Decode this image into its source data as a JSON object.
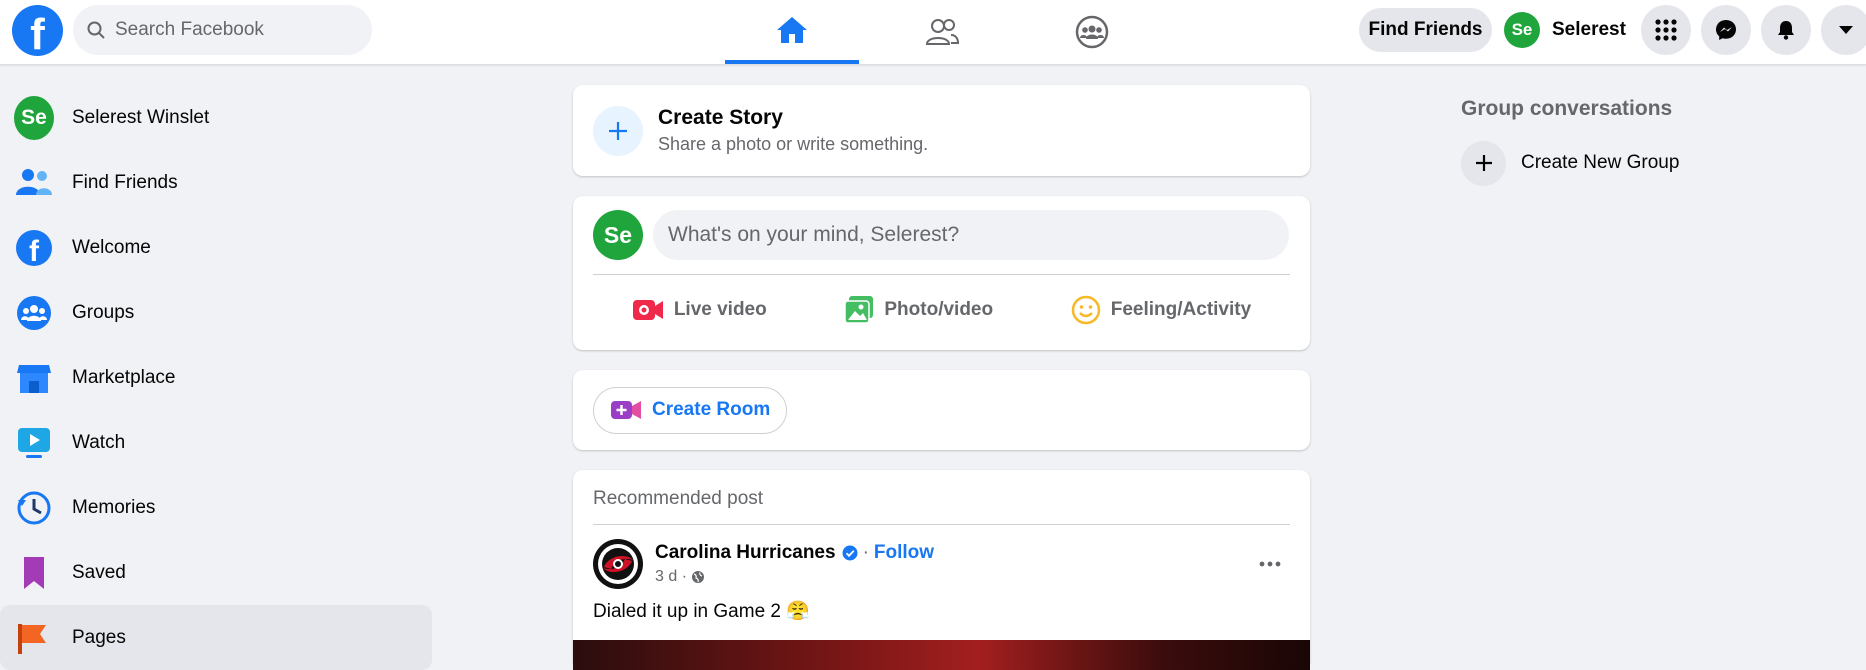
{
  "topbar": {
    "logo_letter": "f",
    "search_placeholder": "Search Facebook",
    "find_friends_label": "Find Friends",
    "profile_name": "Selerest",
    "avatar_text": "Se"
  },
  "left_nav": {
    "items": [
      {
        "label": "Selerest Winslet",
        "icon": "avatar"
      },
      {
        "label": "Find Friends",
        "icon": "friends-icon"
      },
      {
        "label": "Welcome",
        "icon": "facebook-icon"
      },
      {
        "label": "Groups",
        "icon": "groups-icon"
      },
      {
        "label": "Marketplace",
        "icon": "marketplace-icon"
      },
      {
        "label": "Watch",
        "icon": "watch-icon"
      },
      {
        "label": "Memories",
        "icon": "memories-icon"
      },
      {
        "label": "Saved",
        "icon": "saved-icon"
      },
      {
        "label": "Pages",
        "icon": "pages-icon"
      }
    ]
  },
  "create_story": {
    "title": "Create Story",
    "subtitle": "Share a photo or write something."
  },
  "composer": {
    "placeholder": "What's on your mind, Selerest?",
    "actions": [
      "Live video",
      "Photo/video",
      "Feeling/Activity"
    ]
  },
  "room": {
    "label": "Create Room"
  },
  "post": {
    "section_label": "Recommended post",
    "page_name": "Carolina Hurricanes",
    "follow_label": "Follow",
    "separator": "·",
    "time": "3 d ·",
    "text": "Dialed it up in Game 2 😤"
  },
  "right": {
    "title": "Group conversations",
    "create_group_label": "Create New Group"
  },
  "colors": {
    "brand": "#1877f2",
    "avatar_green": "#1fa53b",
    "background": "#f0f2f5"
  }
}
